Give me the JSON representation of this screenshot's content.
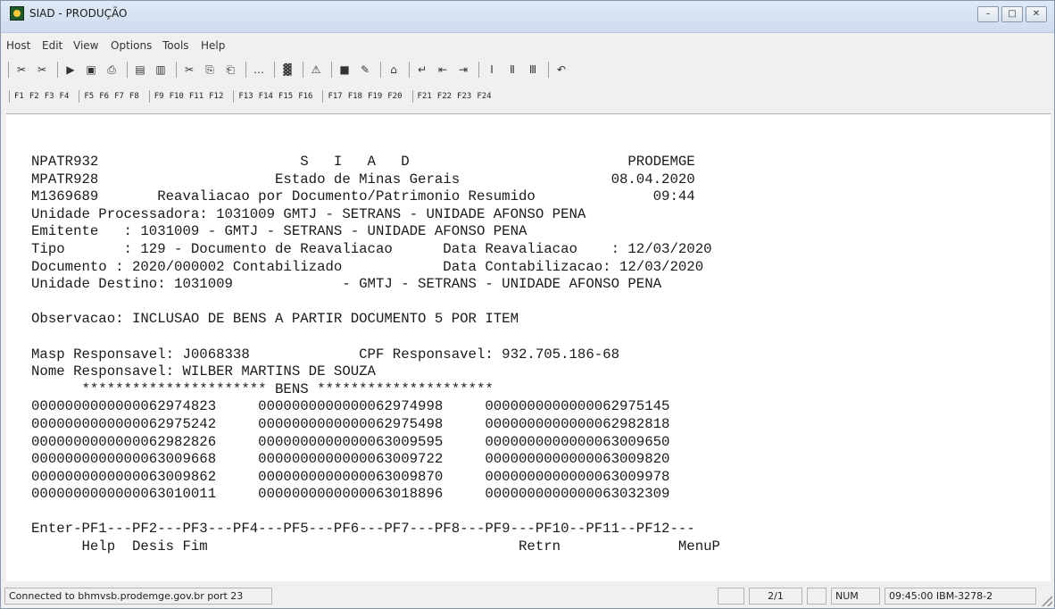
{
  "window": {
    "title": "SIAD - PRODUÇÃO",
    "controls": [
      "minimize",
      "maximize",
      "close"
    ]
  },
  "menu": [
    "Host",
    "Edit",
    "View",
    "Options",
    "Tools",
    "Help"
  ],
  "toolbar_icons": [
    "send-icon",
    "receive-icon",
    "macro-icon",
    "transfer-icon",
    "print-icon",
    "new-session-icon",
    "open-session-icon",
    "cut-icon",
    "copy-icon",
    "paste-icon",
    "dots-icon",
    "chart-icon",
    "warning-icon",
    "screen-icon",
    "pen-icon",
    "home-icon",
    "enter-icon",
    "backtab-icon",
    "tab-icon",
    "pa1-icon",
    "pa2-icon",
    "pa3-icon",
    "undo-icon"
  ],
  "pf_keys": [
    "F1",
    "F2",
    "F3",
    "F4",
    "F5",
    "F6",
    "F7",
    "F8",
    "F9",
    "F10",
    "F11",
    "F12",
    "F13",
    "F14",
    "F15",
    "F16",
    "F17",
    "F18",
    "F19",
    "F20",
    "F21",
    "F22",
    "F23",
    "F24"
  ],
  "terminal": {
    "lines": [
      "NPATR932                        S   I   A   D                          PRODEMGE",
      "MPATR928                     Estado de Minas Gerais                  08.04.2020",
      "M1369689       Reavaliacao por Documento/Patrimonio Resumido              09:44",
      "Unidade Processadora: 1031009 GMTJ - SETRANS - UNIDADE AFONSO PENA",
      "Emitente   : 1031009 - GMTJ - SETRANS - UNIDADE AFONSO PENA",
      "Tipo       : 129 - Documento de Reavaliacao      Data Reavaliacao    : 12/03/2020",
      "Documento : 2020/000002 Contabilizado            Data Contabilizacao: 12/03/2020",
      "Unidade Destino: 1031009             - GMTJ - SETRANS - UNIDADE AFONSO PENA",
      "",
      "Observacao: INCLUSAO DE BENS A PARTIR DOCUMENTO 5 POR ITEM",
      "",
      "Masp Responsavel: J0068338             CPF Responsavel: 932.705.186-68",
      "Nome Responsavel: WILBER MARTINS DE SOUZA",
      "      ********************** BENS *********************",
      "0000000000000062974823     0000000000000062974998     0000000000000062975145",
      "0000000000000062975242     0000000000000062975498     0000000000000062982818",
      "0000000000000062982826     0000000000000063009595     0000000000000063009650",
      "0000000000000063009668     0000000000000063009722     0000000000000063009820",
      "0000000000000063009862     0000000000000063009870     0000000000000063009978",
      "0000000000000063010011     0000000000000063018896     0000000000000063032309",
      "",
      "Enter-PF1---PF2---PF3---PF4---PF5---PF6---PF7---PF8---PF9---PF10--PF11--PF12---",
      "      Help  Desis Fim                                     Retrn              MenuP"
    ]
  },
  "status": {
    "connection": "Connected to bhmvsb.prodemge.gov.br port 23",
    "page": "2/1",
    "num": "NUM",
    "time_type": "09:45:00 IBM-3278-2"
  }
}
